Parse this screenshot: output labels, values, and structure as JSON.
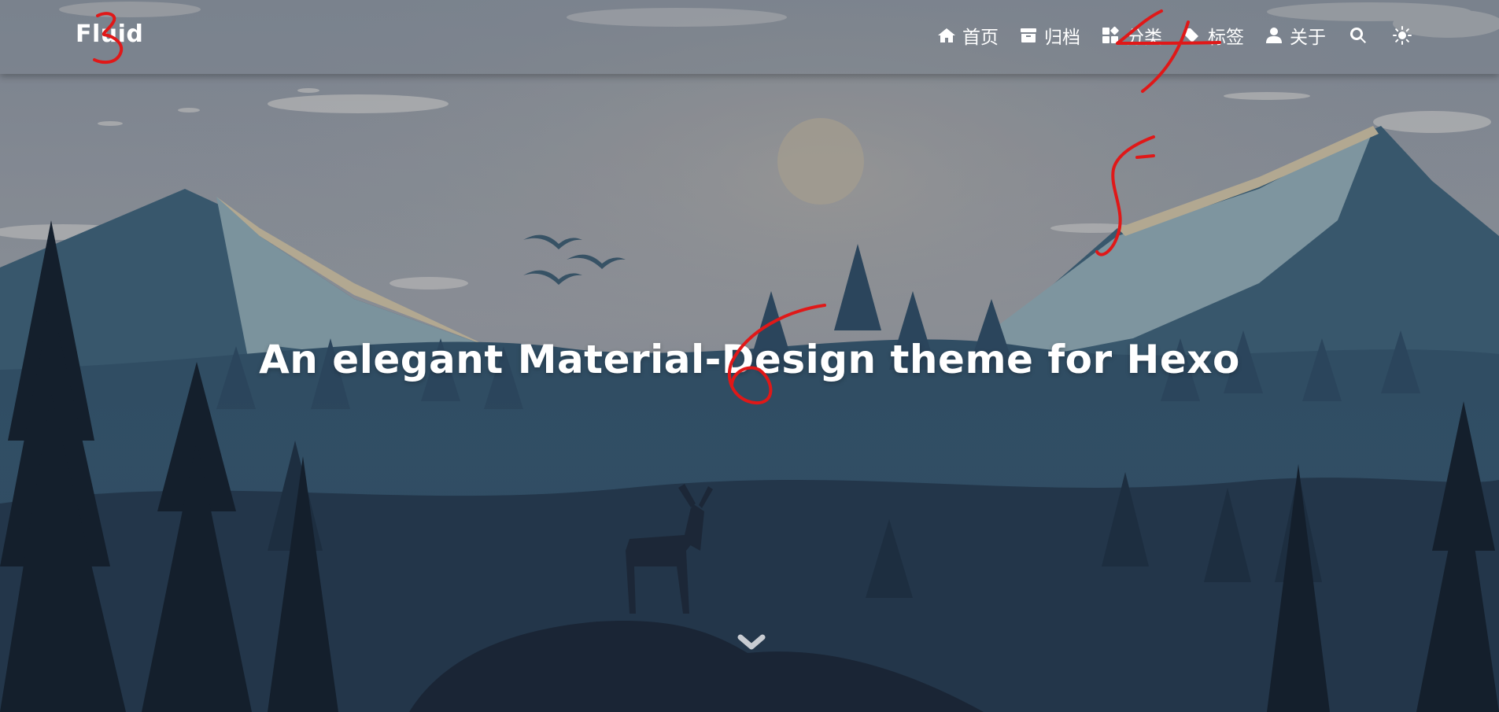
{
  "brand": "Fluid",
  "nav": {
    "items": [
      {
        "label": "首页",
        "icon": "home-icon"
      },
      {
        "label": "归档",
        "icon": "archive-icon"
      },
      {
        "label": "分类",
        "icon": "category-icon"
      },
      {
        "label": "标签",
        "icon": "tag-icon"
      },
      {
        "label": "关于",
        "icon": "user-icon"
      }
    ],
    "search_icon": "search-icon",
    "theme_icon": "sun-icon"
  },
  "hero": {
    "title": "An elegant Material-Design theme for Hexo",
    "scroll_icon": "chevron-down-icon"
  },
  "annotations": [
    "3",
    "4",
    "5",
    "6"
  ],
  "colors": {
    "sky_top": "#8c95a1",
    "mountain_light": "#8fa8b3",
    "forest_dark": "#1d2f40",
    "annotation_red": "#e01818"
  }
}
